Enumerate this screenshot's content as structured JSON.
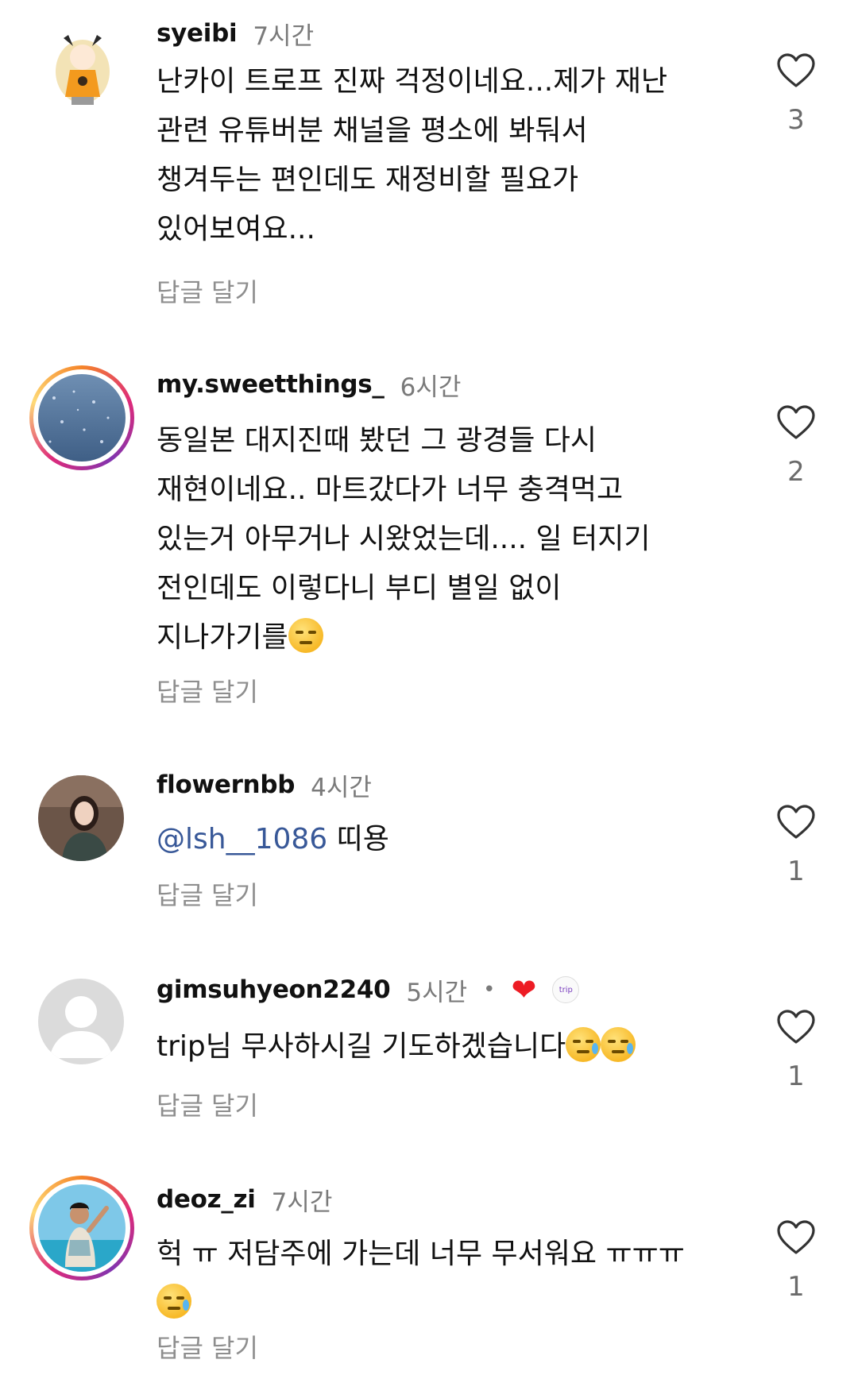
{
  "comments": [
    {
      "username": "syeibi",
      "time": "7시간",
      "lines": [
        "난카이 트로프 진짜 걱정이네요...제가 재난",
        "관련 유튜버분 채널을 평소에 봐둬서",
        "챙겨두는 편인데도 재정비할 필요가",
        "있어보여요..."
      ],
      "reply": "답글 달기",
      "likes": "3",
      "avatar_icon": "anime-character-avatar"
    },
    {
      "username": "my.sweetthings_",
      "time": "6시간",
      "lines": [
        "동일본 대지진때 봤던 그 광경들 다시",
        "재현이네요.. 마트갔다가 너무 충격먹고",
        "있는거 아무거나 시왔었는데.... 일 터지기",
        "전인데도 이렇다니 부디 별일 없이",
        "지나가기를"
      ],
      "reply": "답글 달기",
      "likes": "2",
      "avatar_icon": "sea-water-avatar"
    },
    {
      "username": "flowernbb",
      "time": "4시간",
      "mention": "@lsh__1086",
      "text_after_mention": " 띠용",
      "reply": "답글 달기",
      "likes": "1",
      "avatar_icon": "woman-portrait-avatar"
    },
    {
      "username": "gimsuhyeon2240",
      "time": "5시간",
      "separator": "•",
      "author_badge": "trip",
      "text": "trip님 무사하시길 기도하겠습니다",
      "reply": "답글 달기",
      "likes": "1",
      "avatar_icon": "default-user-avatar"
    },
    {
      "username": "deoz_zi",
      "time": "7시간",
      "text": "헉 ㅠ 저담주에 가는데 너무 무서워요 ㅠㅠㅠ",
      "reply": "답글 달기",
      "likes": "1",
      "avatar_icon": "beach-woman-avatar"
    }
  ],
  "colors": {
    "mention": "#385898",
    "secondary_text": "#8e8e8e",
    "heart_red": "#ed1c24",
    "story_ring": "#dd2a7b"
  }
}
